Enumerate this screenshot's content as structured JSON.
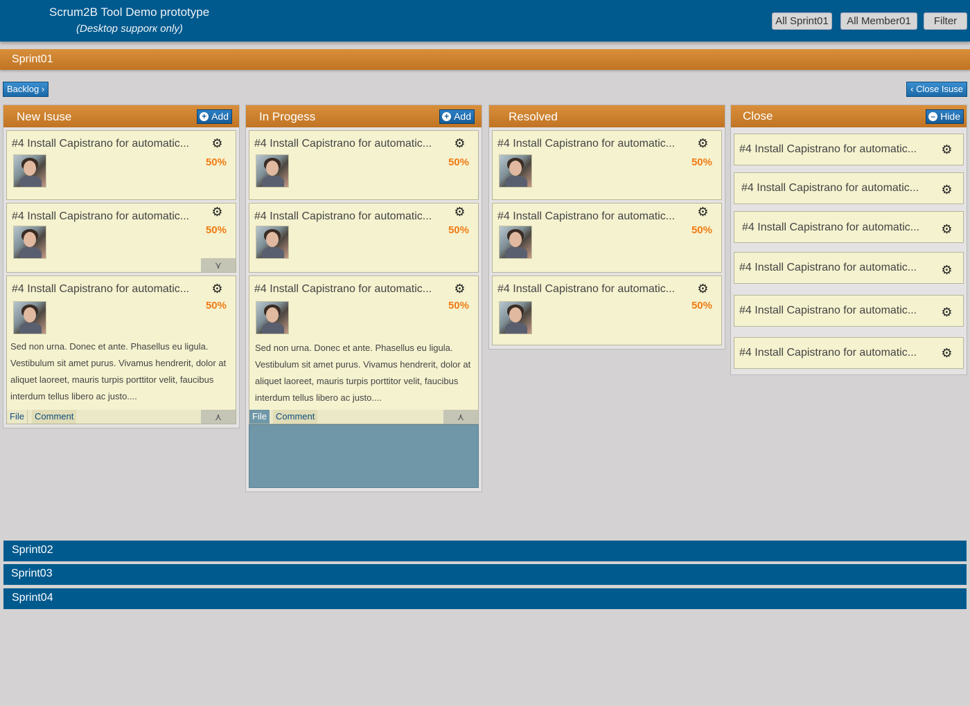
{
  "header": {
    "title": "Scrum2B Tool Demo prototype",
    "subtitle": "(Desktop supporк only)",
    "buttons": [
      "All Sprint01",
      "All Member01",
      "Filter"
    ]
  },
  "sprint_open": "Sprint01",
  "nav": {
    "backlog": "Backlog",
    "close_issue": "Close Isuse"
  },
  "columns": [
    {
      "title": "New Isuse",
      "button": "Add"
    },
    {
      "title": "In Progess",
      "button": "Add"
    },
    {
      "title": "Resolved"
    },
    {
      "title": "Close",
      "button": "Hide"
    }
  ],
  "card": {
    "title": "#4 Install Capistrano for automatic...",
    "percent": "50%",
    "description": "Sed non urna. Donec et ante. Phasellus eu ligula. Vestibulum sit amet purus. Vivamus hendrerit, dolor at aliquet laoreet, mauris turpis porttitor velit, faucibus interdum tellus libero ac justo....",
    "tab_file": "File",
    "tab_comment": "Comment"
  },
  "sprints_collapsed": [
    "Sprint02",
    "Sprint03",
    "Sprint04"
  ],
  "colors": {
    "header": "#005a8e",
    "accent_orange": "#c97f2d",
    "card": "#f5f2cf",
    "percent": "#f07b14"
  },
  "icons": [
    "gear-icon",
    "plus-icon",
    "minus-icon",
    "chevron-down-icon",
    "chevron-up-icon",
    "chevron-right-icon",
    "chevron-left-icon",
    "avatar"
  ]
}
